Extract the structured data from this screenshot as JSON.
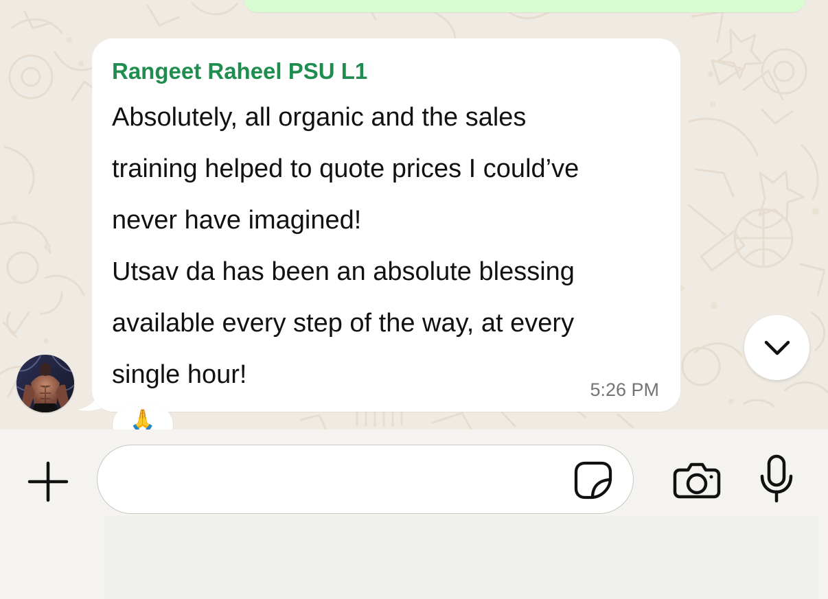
{
  "colors": {
    "chat_background": "#efeae2",
    "outgoing_bubble": "#d9fdd3",
    "incoming_bubble": "#ffffff",
    "sender_name": "#1f8d4f",
    "message_text": "#111111",
    "timestamp": "#747474",
    "composer_background": "#f4f3ef",
    "icon": "#111111"
  },
  "conversation": {
    "message": {
      "sender": "Rangeet Raheel PSU L1",
      "lines": [
        "Absolutely, all organic and the sales",
        "training helped to quote prices I could’ve",
        "never have imagined!",
        "Utsav da has been an absolute blessing",
        "available every step of the way, at every",
        "single hour!"
      ],
      "time": "5:26 PM",
      "reaction": "🙏"
    }
  },
  "icons": {
    "avatar": "avatar",
    "scroll_down": "chevron-down-icon",
    "add": "plus-icon",
    "sticker": "sticker-icon",
    "camera": "camera-icon",
    "microphone": "microphone-icon"
  },
  "composer": {
    "input_value": "",
    "placeholder": ""
  }
}
